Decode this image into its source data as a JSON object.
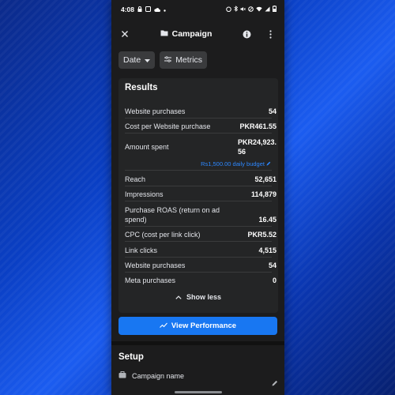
{
  "status_bar": {
    "time": "4:08",
    "left_icons": [
      "lock-icon",
      "screenshot-icon",
      "cloud-icon",
      "dot-icon"
    ],
    "right_icons": [
      "alarm-icon",
      "bluetooth-icon",
      "mute-icon",
      "dnd-icon",
      "wifi-icon",
      "signal-icon",
      "battery-icon"
    ]
  },
  "app_bar": {
    "title": "Campaign",
    "close_icon": "close-icon",
    "folder_icon": "folder-icon",
    "info_icon": "info-icon",
    "menu_icon": "more-vert-icon"
  },
  "filters": {
    "date_label": "Date",
    "metrics_label": "Metrics"
  },
  "results": {
    "title": "Results",
    "rows": [
      {
        "label": "Website purchases",
        "value": "54"
      },
      {
        "label": "Cost per Website purchase",
        "value": "PKR461.55"
      },
      {
        "label": "Amount spent",
        "value": "PKR24,923.\n56"
      },
      {
        "label": "Reach",
        "value": "52,651"
      },
      {
        "label": "Impressions",
        "value": "114,879"
      },
      {
        "label": "Purchase ROAS (return on ad spend)",
        "value": "16.45"
      },
      {
        "label": "CPC (cost per link click)",
        "value": "PKR5.52"
      },
      {
        "label": "Link clicks",
        "value": "4,515"
      },
      {
        "label": "Website purchases",
        "value": "54"
      },
      {
        "label": "Meta purchases",
        "value": "0"
      }
    ],
    "budget_text": "Rs1,500.00 daily budget",
    "show_less": "Show less"
  },
  "view_performance": "View Performance",
  "setup": {
    "title": "Setup",
    "item_label": "Campaign name"
  },
  "colors": {
    "accent": "#1877f2",
    "link": "#2d88ff",
    "card": "#242526",
    "background": "#1c1c1d"
  }
}
